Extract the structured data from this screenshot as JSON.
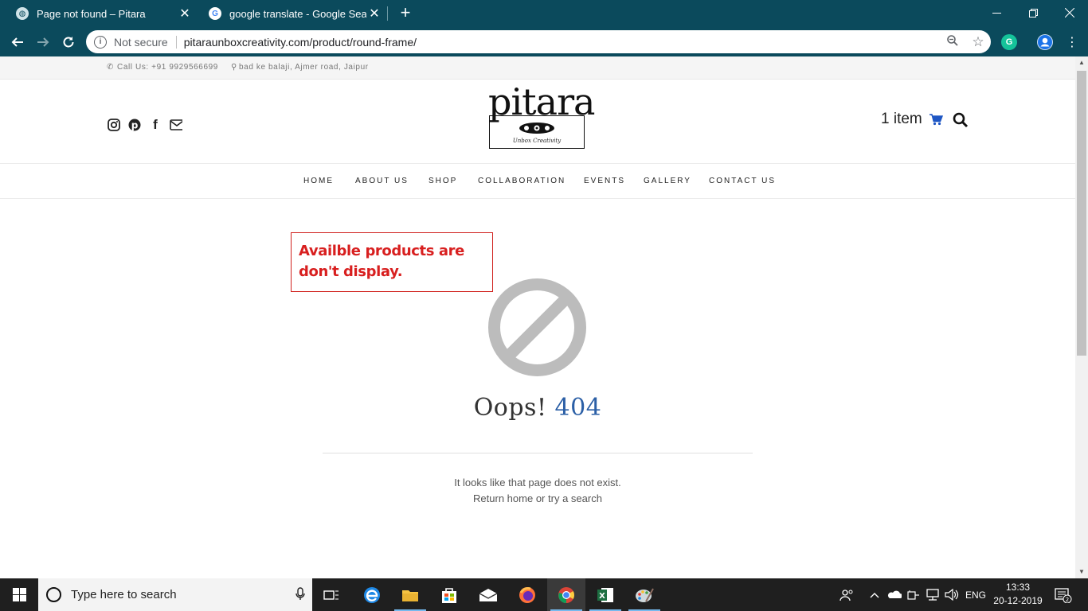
{
  "browser": {
    "tabs": [
      {
        "title": "Page not found – Pitara",
        "active": true
      },
      {
        "title": "google translate - Google Search",
        "active": false
      }
    ],
    "security_label": "Not secure",
    "url": "pitaraunboxcreativity.com/product/round-frame/",
    "new_tab": "+",
    "close_glyph": "✕"
  },
  "site": {
    "topbar": {
      "phone": "Call Us: +91 9929566699",
      "address": "bad ke balaji, Ajmer road, Jaipur"
    },
    "logo_text": "pitara",
    "logo_tagline": "Unbox Creativity",
    "social_icons": [
      "instagram-icon",
      "pinterest-icon",
      "facebook-icon",
      "mail-icon"
    ],
    "cart_label": "1 item",
    "nav": [
      "HOME",
      "ABOUT US",
      "SHOP",
      "COLLABORATION",
      "EVENTS",
      "GALLERY",
      "CONTACT US"
    ]
  },
  "annotation": {
    "text": "Availble products are don't display."
  },
  "error": {
    "oops": "Oops!",
    "code": "404",
    "line1": "It looks like that page does not exist.",
    "line2_link1": "Return home",
    "line2_or": "or",
    "line2_link2": "try a search"
  },
  "taskbar": {
    "search_placeholder": "Type here to search",
    "language": "ENG",
    "time": "13:33",
    "date": "20-12-2019",
    "notification_count": "2"
  },
  "colors": {
    "chrome_frame": "#0b4a5c",
    "accent_blue": "#2b5fa6",
    "annotation_red": "#d81f1f",
    "ban_gray": "#bcbcbc"
  }
}
